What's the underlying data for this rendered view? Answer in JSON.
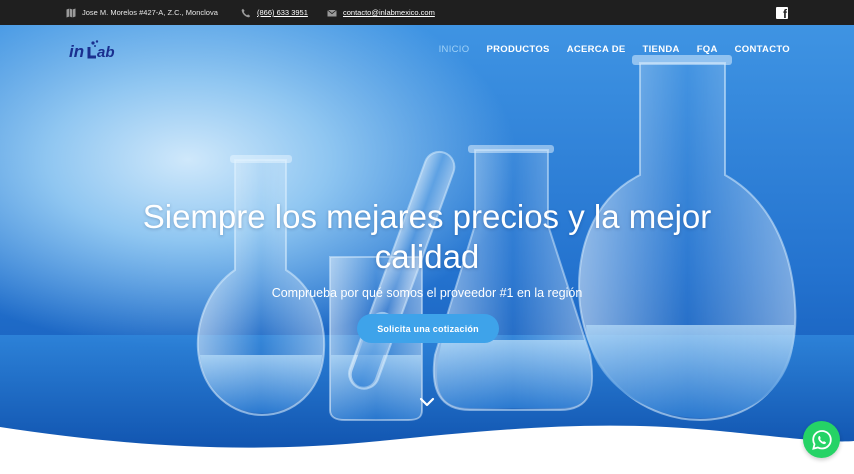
{
  "topbar": {
    "address": "Jose M. Morelos #427-A, Z.C., Monclova",
    "phone": "(866) 633 3951",
    "email": "contacto@inlabmexico.com",
    "icons": [
      "map-icon",
      "phone-icon",
      "envelope-icon",
      "facebook-icon"
    ]
  },
  "nav": {
    "logo_text": "inLab",
    "items": [
      {
        "label": "INICIO",
        "active": true
      },
      {
        "label": "PRODUCTOS",
        "active": false
      },
      {
        "label": "ACERCA DE",
        "active": false
      },
      {
        "label": "TIENDA",
        "active": false
      },
      {
        "label": "FQA",
        "active": false
      },
      {
        "label": "CONTACTO",
        "active": false
      }
    ]
  },
  "hero": {
    "headline": "Siempre los mejares precios y la mejor calidad",
    "subtitle": "Comprueba por qué somos el proveedor #1 en la región",
    "cta": "Solicita una cotización",
    "scroll_icon": "chevron-down-icon"
  },
  "floating": {
    "icon": "whatsapp-icon",
    "color": "#25d366"
  },
  "colors": {
    "topbar": "#1f1f1f",
    "accent": "#3ea3ea",
    "nav_active": "#9fd1f7"
  }
}
